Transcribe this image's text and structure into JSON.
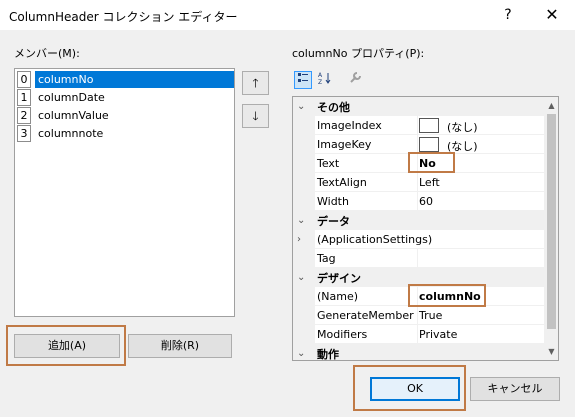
{
  "window": {
    "title": "ColumnHeader コレクション エディター",
    "help_glyph": "?",
    "close_glyph": "✕"
  },
  "members": {
    "label": "メンバー(M):",
    "items": [
      {
        "index": "0",
        "name": "columnNo",
        "selected": true
      },
      {
        "index": "1",
        "name": "columnDate",
        "selected": false
      },
      {
        "index": "2",
        "name": "columnValue",
        "selected": false
      },
      {
        "index": "3",
        "name": "columnnote",
        "selected": false
      }
    ],
    "move_up_glyph": "🡑",
    "move_down_glyph": "🡓"
  },
  "buttons": {
    "add": "追加(A)",
    "remove": "削除(R)",
    "ok": "OK",
    "cancel": "キャンセル"
  },
  "properties": {
    "label": "columnNo プロパティ(P):",
    "toolbar": {
      "categorized_icon": "categorized-view-icon",
      "alphabetical_icon": "alphabetical-sort-icon",
      "property_pages_icon": "wrench-icon"
    },
    "rows": [
      {
        "kind": "category",
        "label": "その他",
        "expander": "⌄"
      },
      {
        "kind": "prop",
        "label": "ImageIndex",
        "value": "(なし)",
        "box": true
      },
      {
        "kind": "prop",
        "label": "ImageKey",
        "value": "(なし)",
        "box": true
      },
      {
        "kind": "prop",
        "label": "Text",
        "value": "No",
        "bold": true
      },
      {
        "kind": "prop",
        "label": "TextAlign",
        "value": "Left"
      },
      {
        "kind": "prop",
        "label": "Width",
        "value": "60"
      },
      {
        "kind": "category",
        "label": "データ",
        "expander": "⌄"
      },
      {
        "kind": "prop",
        "label": "(ApplicationSettings)",
        "value": "",
        "expander": "›"
      },
      {
        "kind": "prop",
        "label": "Tag",
        "value": ""
      },
      {
        "kind": "category",
        "label": "デザイン",
        "expander": "⌄"
      },
      {
        "kind": "prop",
        "label": "(Name)",
        "value": "columnNo",
        "bold": true
      },
      {
        "kind": "prop",
        "label": "GenerateMember",
        "value": "True"
      },
      {
        "kind": "prop",
        "label": "Modifiers",
        "value": "Private"
      },
      {
        "kind": "category",
        "label": "動作",
        "expander": "⌄"
      }
    ],
    "scroll_up_glyph": "▲",
    "scroll_down_glyph": "▼"
  },
  "colors": {
    "highlight": "#c07a46",
    "selection": "#0078d7"
  }
}
